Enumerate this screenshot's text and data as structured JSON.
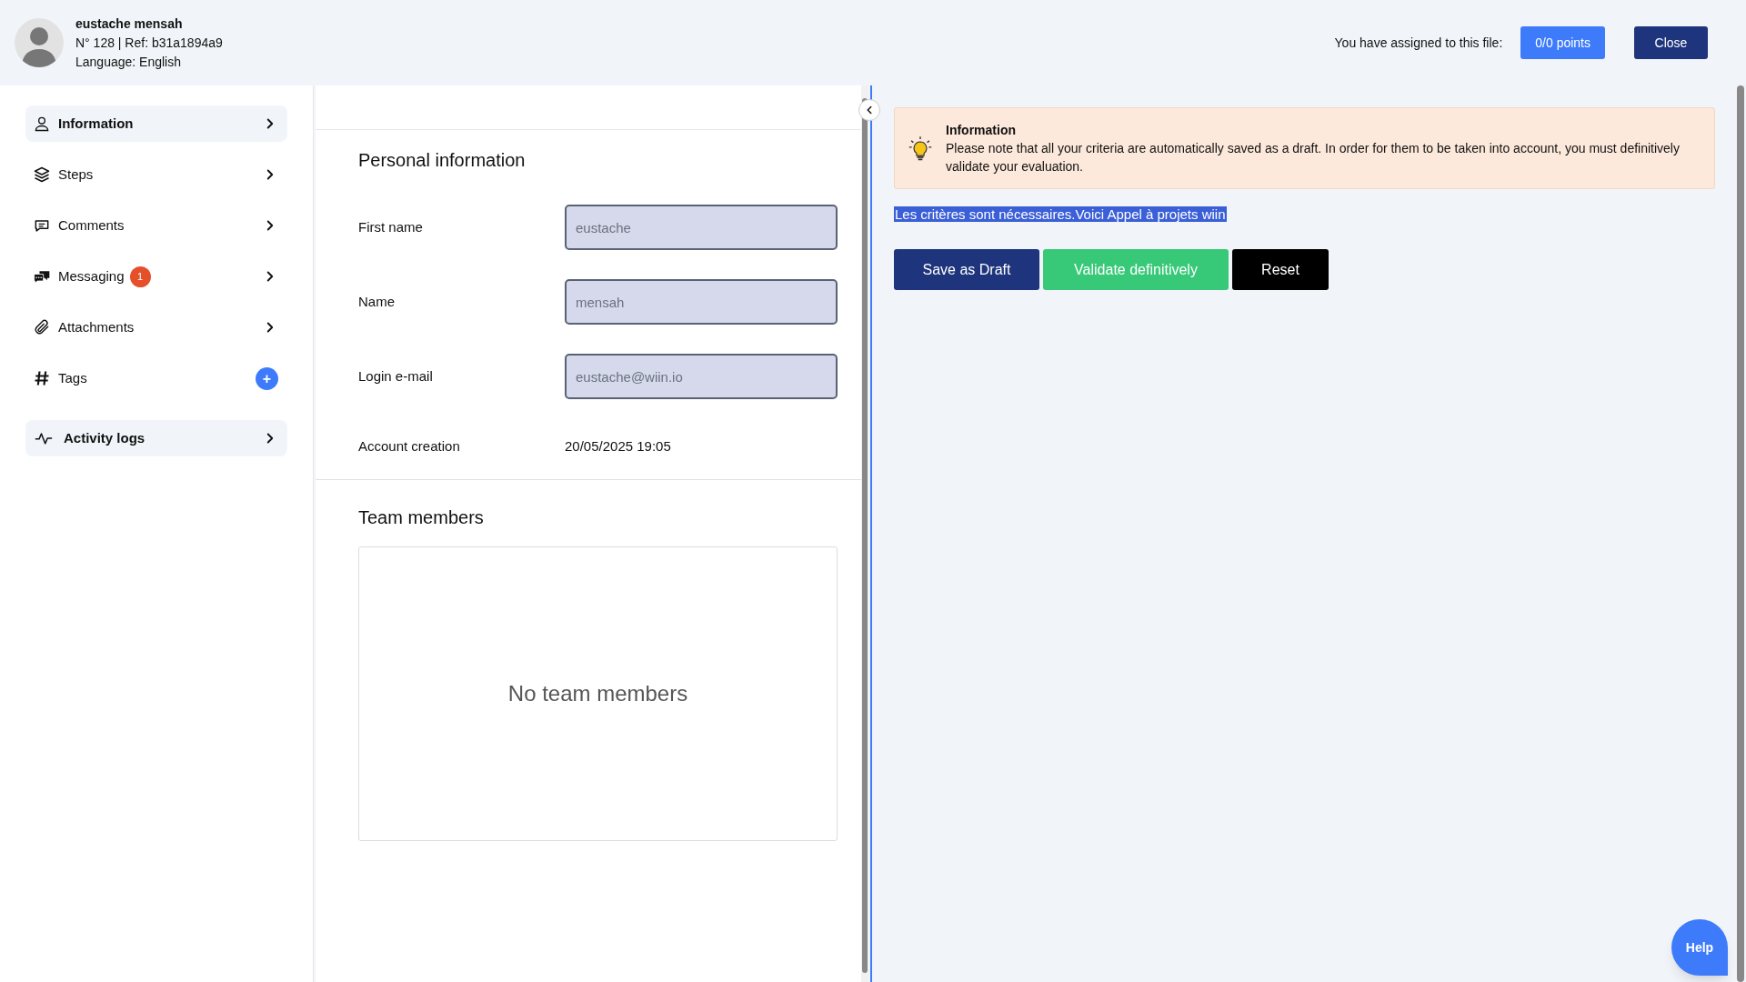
{
  "header": {
    "user_name": "eustache mensah",
    "reference": "N° 128 | Ref: b31a1894a9",
    "language": "Language: English",
    "assigned_label": "You have assigned to this file:",
    "points_button": "0/0 points",
    "close_button": "Close"
  },
  "sidebar": {
    "items": [
      {
        "kind": "nav",
        "label": "Information",
        "selected": true
      },
      {
        "kind": "nav",
        "label": "Steps",
        "selected": false
      },
      {
        "kind": "nav",
        "label": "Comments",
        "selected": false
      },
      {
        "kind": "nav",
        "label": "Messaging",
        "badge": "1",
        "selected": false
      },
      {
        "kind": "nav",
        "label": "Attachments",
        "selected": false
      },
      {
        "kind": "add",
        "label": "Tags",
        "action": "+",
        "selected": false
      }
    ],
    "footer_item": {
      "label": "Activity logs"
    }
  },
  "personal_information": {
    "title": "Personal information",
    "fields": [
      {
        "kind": "input",
        "label": "First name",
        "value": "eustache",
        "disabled": true
      },
      {
        "kind": "input",
        "label": "Name",
        "value": "mensah",
        "disabled": true
      },
      {
        "kind": "input",
        "label": "Login e-mail",
        "value": "eustache@wiin.io",
        "disabled": true
      },
      {
        "kind": "text",
        "label": "Account creation",
        "value": "20/05/2025 19:05"
      }
    ]
  },
  "team_members": {
    "title": "Team members",
    "empty_text": "No team members"
  },
  "info_box": {
    "title": "Information",
    "text": "Please note that all your criteria are automatically saved as a draft. In order for them to be taken into account, you must definitively validate your evaluation."
  },
  "selected_text": "Les critères sont nécessaires.Voici Appel à projets wiin",
  "actions": [
    {
      "kind": "draft",
      "label": "Save as Draft"
    },
    {
      "kind": "validate",
      "label": "Validate definitively"
    },
    {
      "kind": "reset",
      "label": "Reset"
    }
  ],
  "help_button": "Help"
}
